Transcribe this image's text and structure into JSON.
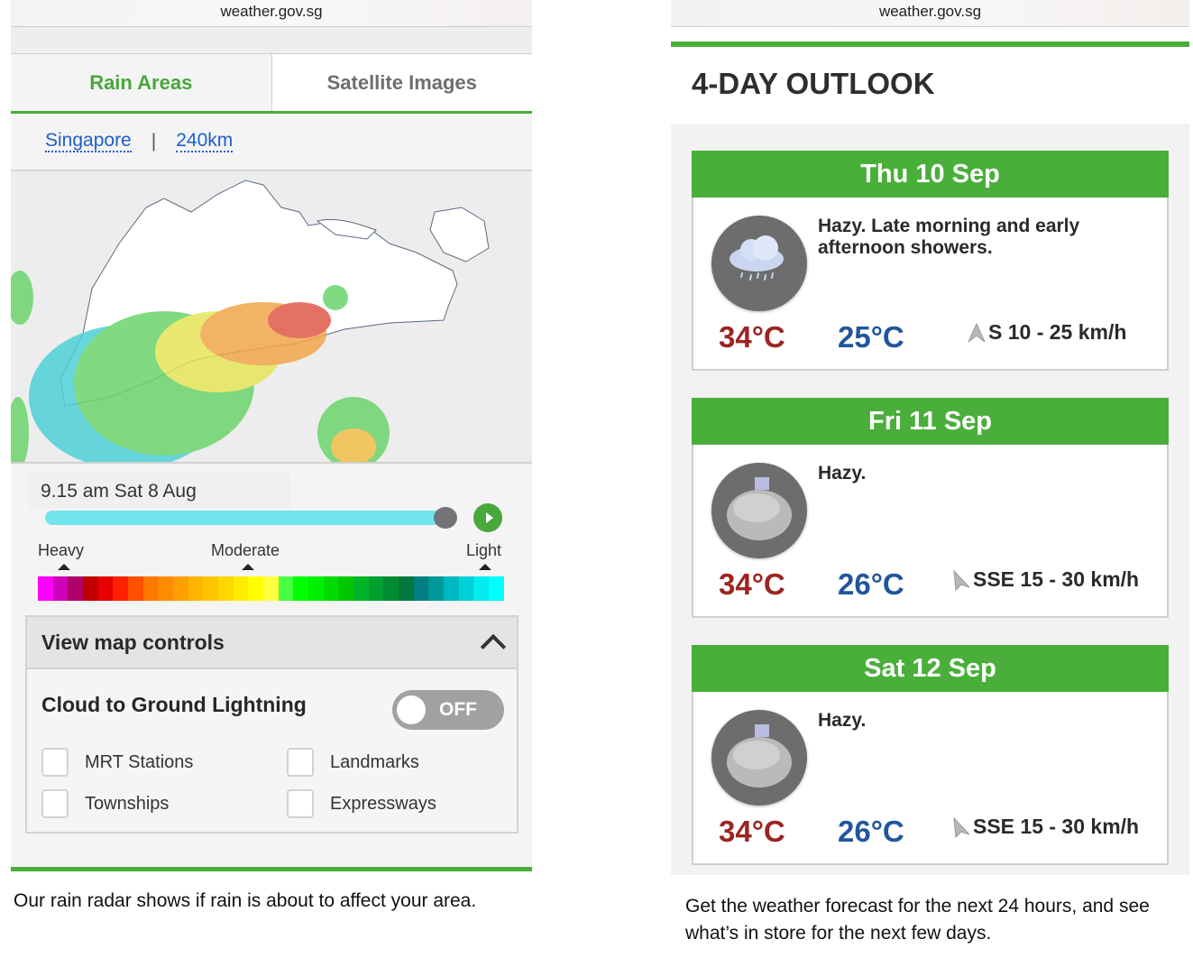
{
  "left": {
    "url": "weather.gov.sg",
    "tabs": [
      {
        "label": "Rain Areas",
        "active": true
      },
      {
        "label": "Satellite Images",
        "active": false
      }
    ],
    "location_links": [
      "Singapore",
      "240km"
    ],
    "location_separator": "|",
    "map": {
      "icon": "rain-radar-map"
    },
    "timestamp": "9.15 am Sat 8 Aug",
    "slider_progress": 1.0,
    "play_icon": "play-icon",
    "legend": {
      "labels": [
        "Heavy",
        "Moderate",
        "Light"
      ],
      "colors": [
        "#ff00ff",
        "#d000b8",
        "#b0006a",
        "#c00000",
        "#e60000",
        "#ff2000",
        "#ff5000",
        "#ff7800",
        "#ff8c00",
        "#ffa000",
        "#ffb400",
        "#ffc400",
        "#ffd800",
        "#ffec00",
        "#ffff00",
        "#ffff40",
        "#48ff40",
        "#00ff00",
        "#00f000",
        "#00dc00",
        "#00c800",
        "#00b428",
        "#00a030",
        "#008c30",
        "#007840",
        "#008080",
        "#009898",
        "#00b8c0",
        "#00d0d8",
        "#00ecf0",
        "#00ffff"
      ]
    },
    "map_controls": {
      "title": "View map controls",
      "collapse_icon": "chevron-up-icon",
      "lightning_label": "Cloud to Ground Lightning",
      "lightning_toggle": "OFF",
      "checkboxes": [
        {
          "label": "MRT Stations",
          "checked": false
        },
        {
          "label": "Landmarks",
          "checked": false
        },
        {
          "label": "Townships",
          "checked": false
        },
        {
          "label": "Expressways",
          "checked": false
        }
      ]
    },
    "caption": "Our rain radar shows if rain is about to affect your area."
  },
  "right": {
    "url": "weather.gov.sg",
    "title": "4-DAY OUTLOOK",
    "days": [
      {
        "date": "Thu 10 Sep",
        "icon": "rain-cloud-icon",
        "description": "Hazy. Late morning and early afternoon showers.",
        "high": "34°C",
        "low": "25°C",
        "wind": "S 10 - 25 km/h",
        "wind_dir": "S"
      },
      {
        "date": "Fri 11 Sep",
        "icon": "haze-icon",
        "description": "Hazy.",
        "high": "34°C",
        "low": "26°C",
        "wind": "SSE 15 - 30 km/h",
        "wind_dir": "SSE"
      },
      {
        "date": "Sat 12 Sep",
        "icon": "haze-icon",
        "description": "Hazy.",
        "high": "34°C",
        "low": "26°C",
        "wind": "SSE 15 - 30 km/h",
        "wind_dir": "SSE"
      }
    ],
    "caption": "Get the weather forecast for the next 24 hours, and see what’s in store for the next few days."
  },
  "colors": {
    "brand_green": "#4aae3a",
    "link_blue": "#1e5fc8",
    "temp_high": "#9b2523",
    "temp_low": "#21569c"
  }
}
